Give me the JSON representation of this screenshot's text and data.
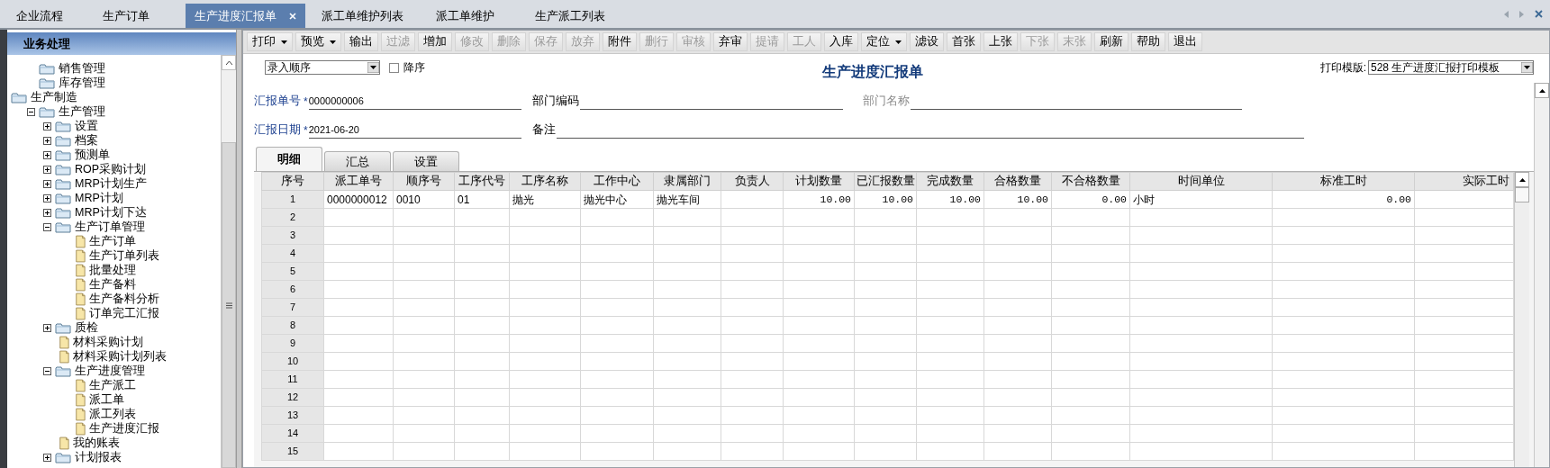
{
  "tabs": [
    {
      "label": "企业流程",
      "selected": false,
      "closable": false
    },
    {
      "label": "生产订单",
      "selected": false,
      "closable": false
    },
    {
      "label": "生产进度汇报单",
      "selected": true,
      "closable": true
    },
    {
      "label": "派工单维护列表",
      "selected": false,
      "closable": false
    },
    {
      "label": "派工单维护",
      "selected": false,
      "closable": false
    },
    {
      "label": "生产派工列表",
      "selected": false,
      "closable": false
    }
  ],
  "sidebar": {
    "title": "业务处理",
    "tree": [
      {
        "label": "销售管理",
        "kind": "folder"
      },
      {
        "label": "库存管理",
        "kind": "folder"
      },
      {
        "label": "生产制造",
        "kind": "folder",
        "children": [
          {
            "label": "生产管理",
            "kind": "folder",
            "expanded": true,
            "children": [
              {
                "label": "设置",
                "kind": "folder",
                "expanded": false
              },
              {
                "label": "档案",
                "kind": "folder",
                "expanded": false
              },
              {
                "label": "预测单",
                "kind": "folder",
                "expanded": false
              },
              {
                "label": "ROP采购计划",
                "kind": "folder",
                "expanded": false
              },
              {
                "label": "MRP计划生产",
                "kind": "folder",
                "expanded": false
              },
              {
                "label": "MRP计划",
                "kind": "folder",
                "expanded": false
              },
              {
                "label": "MRP计划下达",
                "kind": "folder",
                "expanded": false
              },
              {
                "label": "生产订单管理",
                "kind": "folder",
                "expanded": true,
                "children": [
                  {
                    "label": "生产订单",
                    "kind": "doc"
                  },
                  {
                    "label": "生产订单列表",
                    "kind": "doc"
                  },
                  {
                    "label": "批量处理",
                    "kind": "doc"
                  },
                  {
                    "label": "生产备料",
                    "kind": "doc"
                  },
                  {
                    "label": "生产备料分析",
                    "kind": "doc"
                  },
                  {
                    "label": "订单完工汇报",
                    "kind": "doc"
                  }
                ]
              },
              {
                "label": "质检",
                "kind": "folder",
                "expanded": false
              },
              {
                "label": "材料采购计划",
                "kind": "doc"
              },
              {
                "label": "材料采购计划列表",
                "kind": "doc"
              },
              {
                "label": "生产进度管理",
                "kind": "folder",
                "expanded": true,
                "children": [
                  {
                    "label": "生产派工",
                    "kind": "doc"
                  },
                  {
                    "label": "派工单",
                    "kind": "doc"
                  },
                  {
                    "label": "派工列表",
                    "kind": "doc"
                  },
                  {
                    "label": "生产进度汇报",
                    "kind": "doc"
                  }
                ]
              },
              {
                "label": "我的账表",
                "kind": "doc"
              },
              {
                "label": "计划报表",
                "kind": "folder",
                "expanded": false
              }
            ]
          }
        ]
      }
    ]
  },
  "toolbar": [
    {
      "label": "打印",
      "disabled": false,
      "dropdown": true
    },
    {
      "label": "预览",
      "disabled": false,
      "dropdown": true
    },
    {
      "label": "输出",
      "disabled": false,
      "dropdown": false
    },
    {
      "label": "过滤",
      "disabled": true,
      "dropdown": false
    },
    {
      "label": "增加",
      "disabled": false,
      "dropdown": false
    },
    {
      "label": "修改",
      "disabled": true,
      "dropdown": false
    },
    {
      "label": "删除",
      "disabled": true,
      "dropdown": false
    },
    {
      "label": "保存",
      "disabled": true,
      "dropdown": false
    },
    {
      "label": "放弃",
      "disabled": true,
      "dropdown": false
    },
    {
      "label": "附件",
      "disabled": false,
      "dropdown": false
    },
    {
      "label": "删行",
      "disabled": true,
      "dropdown": false
    },
    {
      "label": "审核",
      "disabled": true,
      "dropdown": false
    },
    {
      "label": "弃审",
      "disabled": false,
      "dropdown": false
    },
    {
      "label": "提请",
      "disabled": true,
      "dropdown": false
    },
    {
      "label": "工人",
      "disabled": true,
      "dropdown": false
    },
    {
      "label": "入库",
      "disabled": false,
      "dropdown": false
    },
    {
      "label": "定位",
      "disabled": false,
      "dropdown": true
    },
    {
      "label": "滤设",
      "disabled": false,
      "dropdown": false
    },
    {
      "label": "首张",
      "disabled": false,
      "dropdown": false
    },
    {
      "label": "上张",
      "disabled": false,
      "dropdown": false
    },
    {
      "label": "下张",
      "disabled": true,
      "dropdown": false
    },
    {
      "label": "末张",
      "disabled": true,
      "dropdown": false
    },
    {
      "label": "刷新",
      "disabled": false,
      "dropdown": false
    },
    {
      "label": "帮助",
      "disabled": false,
      "dropdown": false
    },
    {
      "label": "退出",
      "disabled": false,
      "dropdown": false
    }
  ],
  "form": {
    "sort_select": "录入顺序",
    "descending": {
      "label": "降序",
      "checked": false
    },
    "title": "生产进度汇报单",
    "print_template": {
      "label": "打印模版:",
      "value": "528 生产进度汇报打印模板"
    },
    "field_rows": [
      [
        {
          "label": "汇报单号",
          "required_mark": "*",
          "disabled": false,
          "value": "0000000006"
        },
        {
          "label": "部门编码",
          "disabled": false
        },
        {
          "label": "部门名称",
          "disabled": true
        }
      ],
      [
        {
          "label": "汇报日期",
          "required_mark": "*",
          "disabled": false,
          "value": "2021-06-20"
        },
        {
          "label": "备注",
          "disabled": false
        }
      ]
    ]
  },
  "detail_tabs": [
    {
      "label": "明细",
      "selected": true
    },
    {
      "label": "汇总",
      "selected": false
    },
    {
      "label": "设置",
      "selected": false
    }
  ],
  "table": {
    "columns": [
      "序号",
      "派工单号",
      "顺序号",
      "工序代号",
      "工序名称",
      "工作中心",
      "隶属部门",
      "负责人",
      "计划数量",
      "已汇报数量",
      "完成数量",
      "合格数量",
      "不合格数量",
      "时间单位",
      "标准工时",
      "实际工时"
    ],
    "rows": [
      {
        "number": "1",
        "cells": [
          "0000000012",
          "0010",
          "01",
          "抛光",
          "抛光中心",
          "抛光车间",
          null,
          "10.00",
          "10.00",
          "10.00",
          "10.00",
          "0.00",
          "小时",
          "0.00",
          null
        ]
      },
      {
        "number": "2"
      },
      {
        "number": "3"
      },
      {
        "number": "4"
      },
      {
        "number": "5"
      },
      {
        "number": "6"
      },
      {
        "number": "7"
      },
      {
        "number": "8"
      },
      {
        "number": "9"
      },
      {
        "number": "10"
      },
      {
        "number": "11"
      },
      {
        "number": "12"
      },
      {
        "number": "13"
      },
      {
        "number": "14"
      },
      {
        "number": "15"
      }
    ]
  }
}
